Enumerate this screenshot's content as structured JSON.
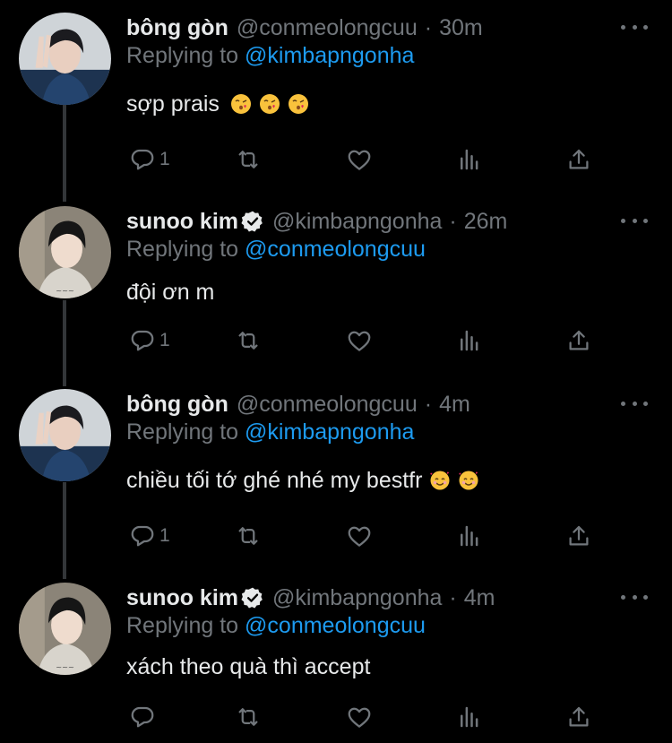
{
  "colors": {
    "background": "#000000",
    "text_primary": "#e7e9ea",
    "text_secondary": "#71767b",
    "mention": "#1d9bf0",
    "verified": "#1d9bf0",
    "thread_line": "#333639"
  },
  "tweets": [
    {
      "display_name": "bông gòn",
      "handle": "@conmeolongcuu",
      "separator": "·",
      "time": "30m",
      "verified": false,
      "replying_prefix": "Replying to",
      "replying_to": "@kimbapngonha",
      "text": "sợp prais",
      "emojis": [
        "kissing-face-heart-icon",
        "kissing-face-heart-icon",
        "kissing-face-heart-icon"
      ],
      "reply_count": "1"
    },
    {
      "display_name": "sunoo kim",
      "handle": "@kimbapngonha",
      "separator": "·",
      "time": "26m",
      "verified": true,
      "replying_prefix": "Replying to",
      "replying_to": "@conmeolongcuu",
      "text": "đội ơn m",
      "emojis": [],
      "reply_count": "1"
    },
    {
      "display_name": "bông gòn",
      "handle": "@conmeolongcuu",
      "separator": "·",
      "time": "4m",
      "verified": false,
      "replying_prefix": "Replying to",
      "replying_to": "@kimbapngonha",
      "text": "chiều tối tớ ghé nhé my bestfr",
      "emojis": [
        "smiling-face-hearts-icon",
        "smiling-face-hearts-icon"
      ],
      "reply_count": "1"
    },
    {
      "display_name": "sunoo kim",
      "handle": "@kimbapngonha",
      "separator": "·",
      "time": "4m",
      "verified": true,
      "replying_prefix": "Replying to",
      "replying_to": "@conmeolongcuu",
      "text": "xách theo quà thì accept",
      "emojis": [],
      "reply_count": ""
    }
  ],
  "action_icons": [
    "reply-icon",
    "retweet-icon",
    "like-icon",
    "views-icon",
    "share-icon"
  ]
}
